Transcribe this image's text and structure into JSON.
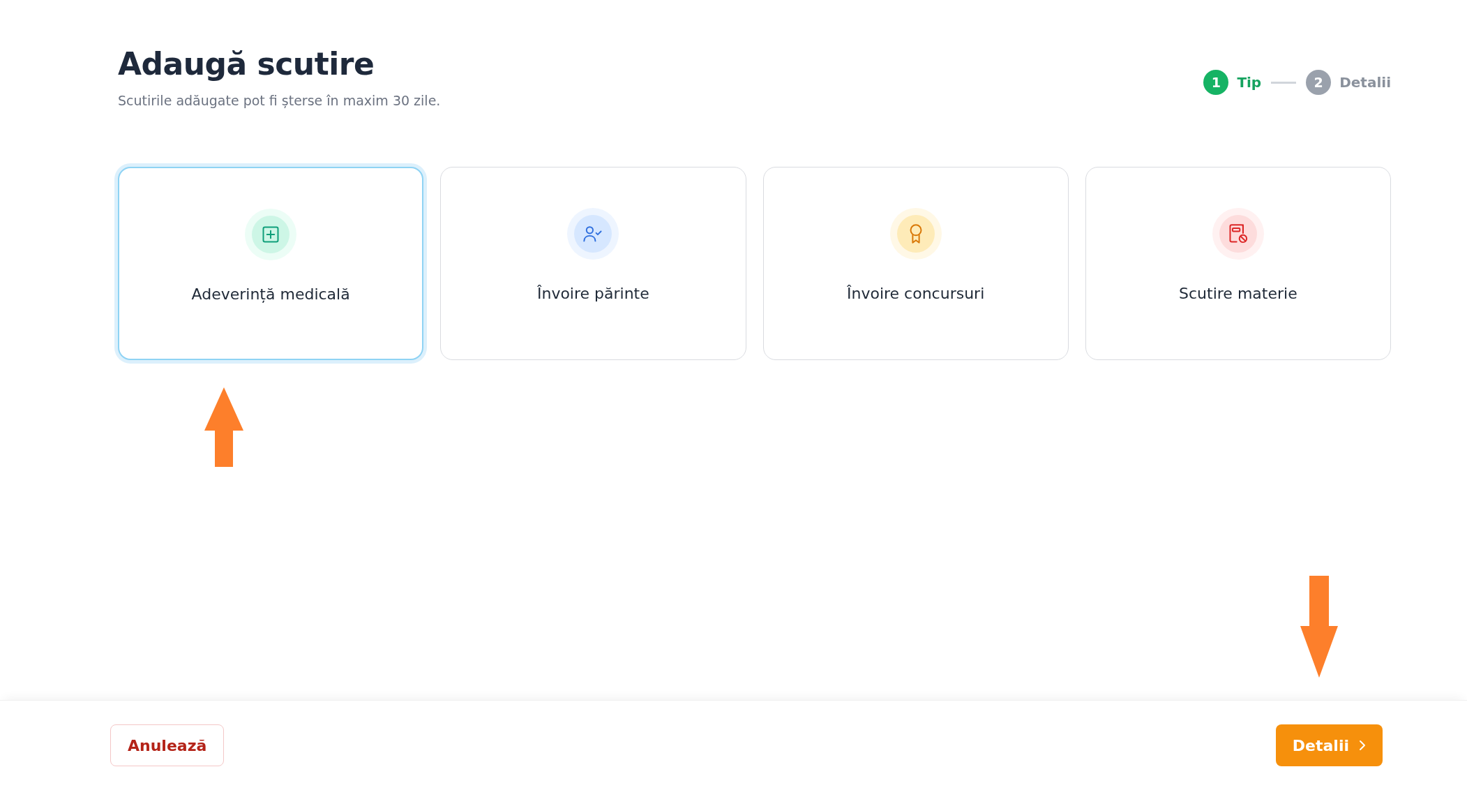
{
  "header": {
    "title": "Adaugă scutire",
    "subtitle": "Scutirile adăugate pot fi șterse în maxim 30 zile."
  },
  "steps": [
    {
      "number": "1",
      "label": "Tip",
      "selected": true
    },
    {
      "number": "2",
      "label": "Detalii",
      "selected": false
    }
  ],
  "options": [
    {
      "kind": "medical",
      "label": "Adeverință medicală",
      "color": "#0f9f7a",
      "selected": true
    },
    {
      "kind": "parent",
      "label": "Învoire părinte",
      "color": "#2f6fde",
      "selected": false
    },
    {
      "kind": "award",
      "label": "Învoire concursuri",
      "color": "#d97706",
      "selected": false
    },
    {
      "kind": "subject",
      "label": "Scutire materie",
      "color": "#dc2626",
      "selected": false
    }
  ],
  "footer": {
    "cancel": "Anulează",
    "next": "Detalii"
  }
}
